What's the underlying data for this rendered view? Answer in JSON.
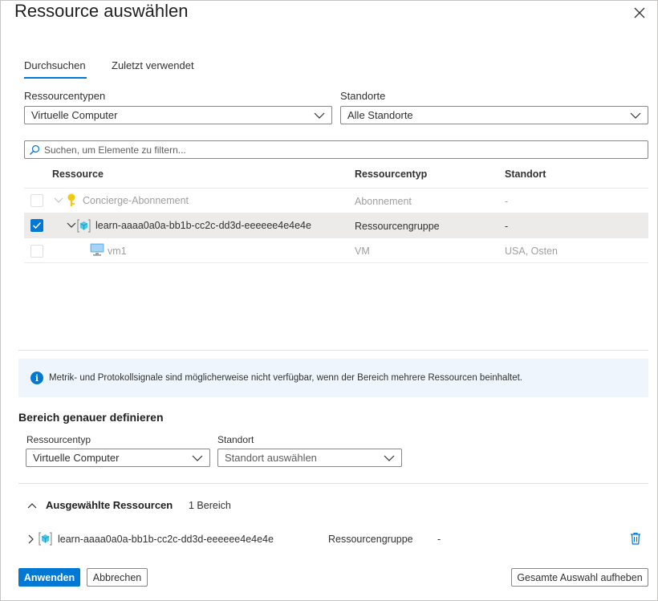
{
  "dialog": {
    "title": "Ressource auswählen"
  },
  "tabs": [
    {
      "label": "Durchsuchen",
      "active": true
    },
    {
      "label": "Zuletzt verwendet",
      "active": false
    }
  ],
  "filters": {
    "resource_types_label": "Ressourcentypen",
    "resource_types_value": "Virtuelle Computer",
    "locations_label": "Standorte",
    "locations_value": "Alle Standorte"
  },
  "search": {
    "placeholder": "Suchen, um Elemente zu filtern..."
  },
  "table": {
    "columns": [
      "Ressource",
      "Ressourcentyp",
      "Standort"
    ],
    "rows": [
      {
        "name": "Concierge-Abonnement",
        "type": "Abonnement",
        "location": "-",
        "checked": false,
        "disabled": true,
        "icon": "key-icon"
      },
      {
        "name": "learn-aaaa0a0a-bb1b-cc2c-dd3d-eeeeee4e4e4e",
        "type": "Ressourcengruppe",
        "location": "-",
        "checked": true,
        "disabled": false,
        "icon": "resource-group-icon"
      },
      {
        "name": "vm1",
        "type": "VM",
        "location": "USA, Osten",
        "checked": false,
        "disabled": true,
        "icon": "vm-icon"
      }
    ]
  },
  "info_banner": {
    "text": "Metrik- und Protokollsignale sind möglicherweise nicht verfügbar, wenn der Bereich mehrere Ressourcen beinhaltet."
  },
  "refine": {
    "heading": "Bereich genauer definieren",
    "resource_type_label": "Ressourcentyp",
    "resource_type_value": "Virtuelle Computer",
    "location_label": "Standort",
    "location_placeholder": "Standort auswählen"
  },
  "selected": {
    "heading": "Ausgewählte Ressourcen",
    "count": "1 Bereich",
    "items": [
      {
        "name": "learn-aaaa0a0a-bb1b-cc2c-dd3d-eeeeee4e4e4e",
        "type": "Ressourcengruppe",
        "location": "-"
      }
    ]
  },
  "footer": {
    "apply_label": "Anwenden",
    "cancel_label": "Abbrechen",
    "clear_label": "Gesamte Auswahl aufheben"
  },
  "colors": {
    "accent": "#0078d4",
    "info_bg": "#eef5fd",
    "selected_row_bg": "#edebe9"
  }
}
